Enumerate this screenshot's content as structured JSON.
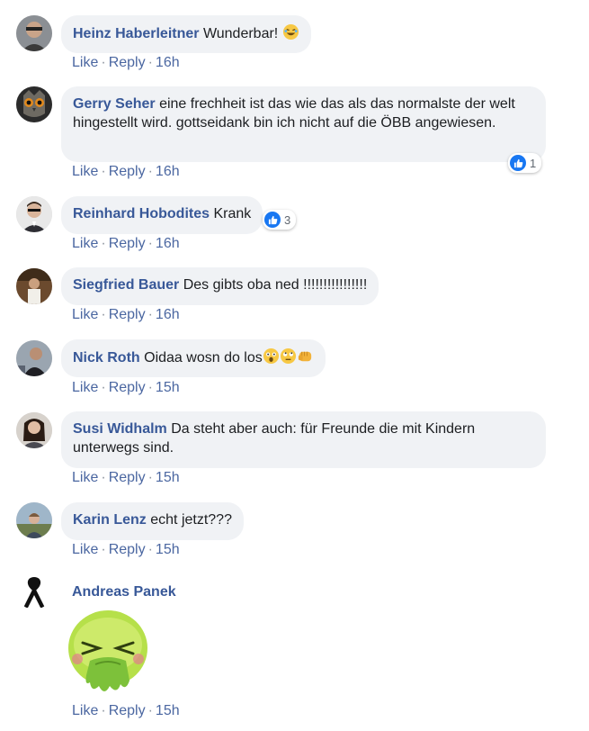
{
  "comments": [
    {
      "author": "Heinz Haberleitner",
      "text": "Wunderbar!",
      "emojis": [
        "rofl"
      ],
      "like": "Like",
      "reply": "Reply",
      "time": "16h"
    },
    {
      "author": "Gerry Seher",
      "text": "eine frechheit ist das wie das als das normalste der welt hingestellt wird. gottseidank bin ich nicht auf die ÖBB angewiesen.",
      "like": "Like",
      "reply": "Reply",
      "time": "16h",
      "reaction_count": "1"
    },
    {
      "author": "Reinhard Hobodites",
      "text": "Krank",
      "like": "Like",
      "reply": "Reply",
      "time": "16h",
      "reaction_count": "3"
    },
    {
      "author": "Siegfried Bauer",
      "text": "Des gibts oba ned !!!!!!!!!!!!!!!!",
      "like": "Like",
      "reply": "Reply",
      "time": "16h"
    },
    {
      "author": "Nick Roth",
      "text": "Oidaa wosn do los",
      "emojis": [
        "astonished",
        "rolling-eyes",
        "fist"
      ],
      "like": "Like",
      "reply": "Reply",
      "time": "15h"
    },
    {
      "author": "Susi Widhalm",
      "text": "Da steht aber auch: für Freunde die mit Kindern unterwegs sind.",
      "like": "Like",
      "reply": "Reply",
      "time": "15h"
    },
    {
      "author": "Karin Lenz",
      "text": "echt jetzt???",
      "like": "Like",
      "reply": "Reply",
      "time": "15h"
    },
    {
      "author": "Andreas Panek",
      "sticker": "vomiting-face-sticker",
      "like": "Like",
      "reply": "Reply",
      "time": "15h"
    }
  ],
  "colors": {
    "author": "#385898",
    "bubble": "#f0f2f5",
    "link": "#4b67a1",
    "like_blue": "#1877f2"
  },
  "separator": "·"
}
